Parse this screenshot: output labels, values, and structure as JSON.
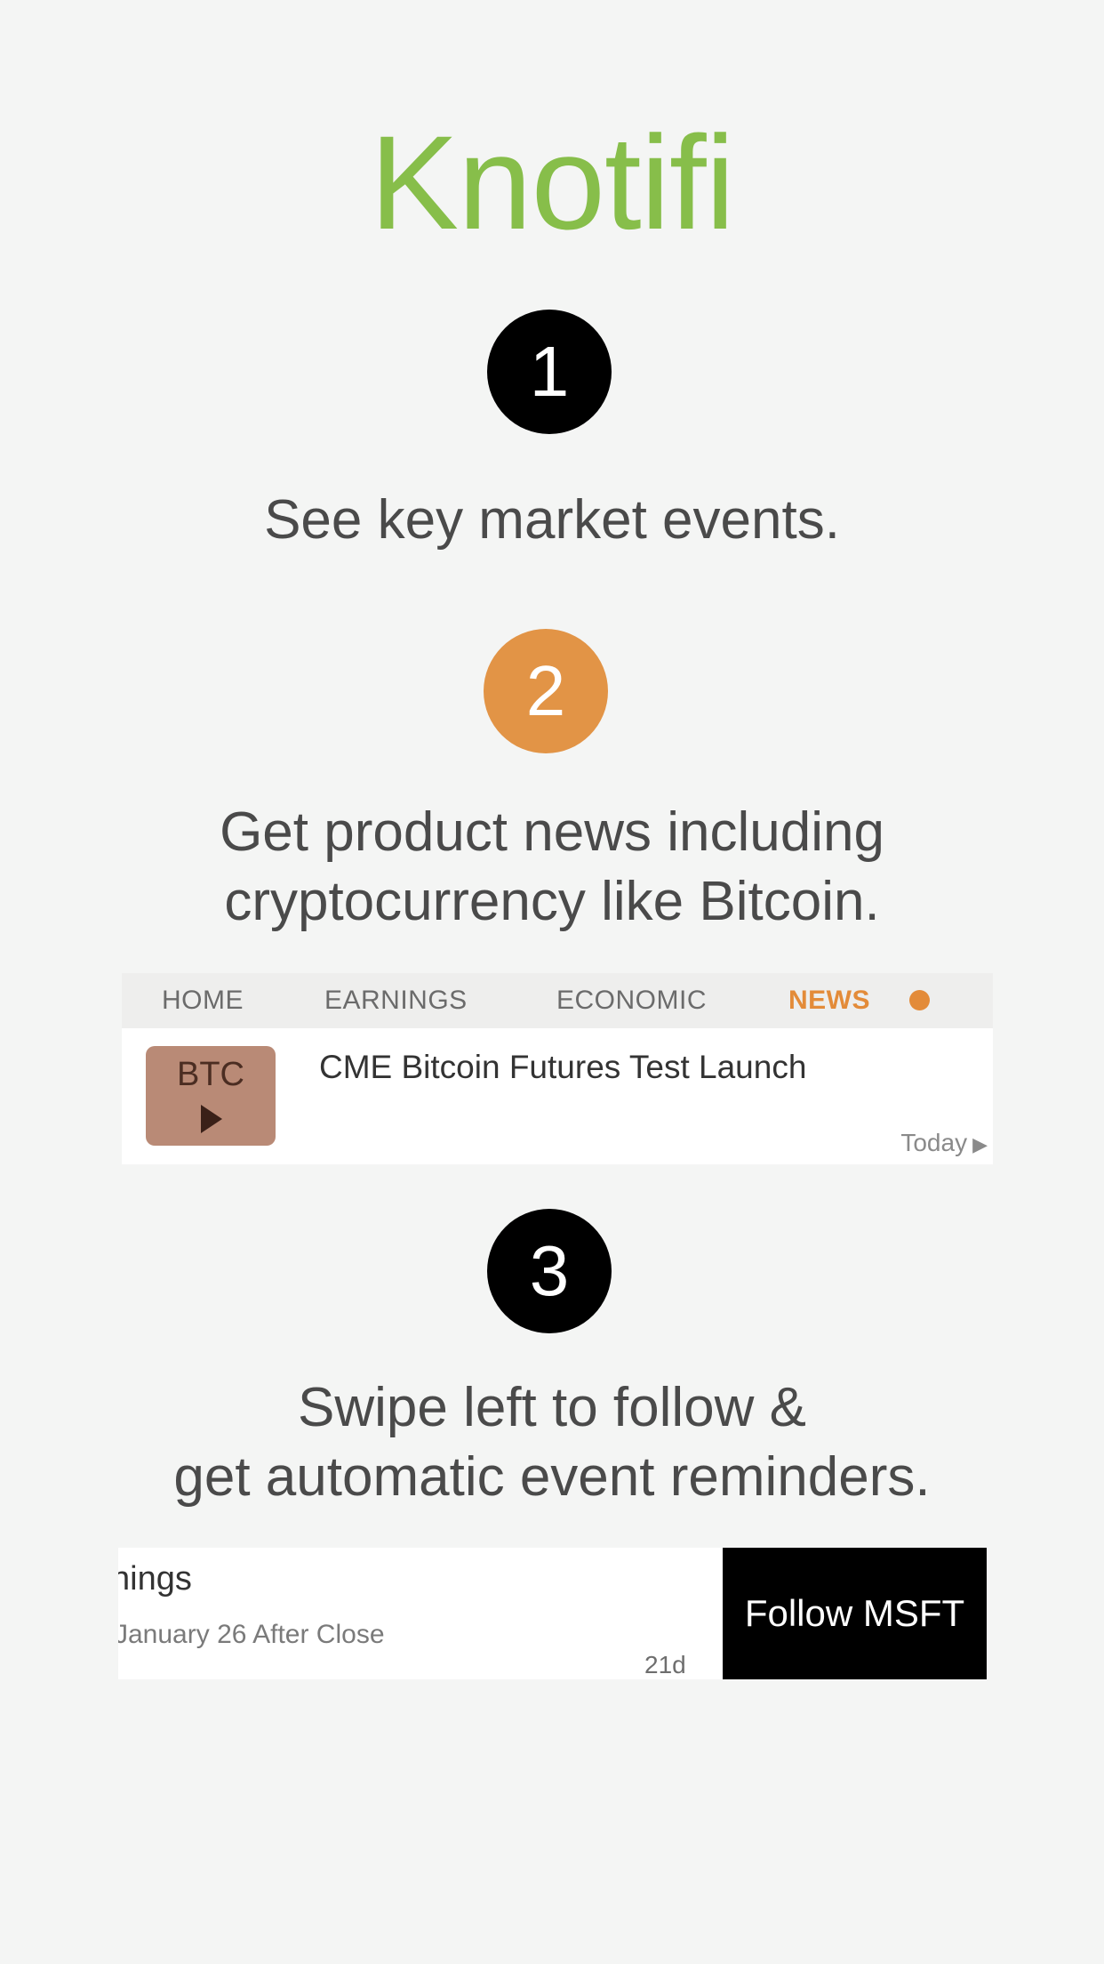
{
  "app": {
    "title": "Knotifi"
  },
  "steps": [
    {
      "number": "1",
      "caption_line1": "See key market events.",
      "color": "#000000"
    },
    {
      "number": "2",
      "caption_line1": "Get product news including",
      "caption_line2": "cryptocurrency like Bitcoin.",
      "color": "#e29446"
    },
    {
      "number": "3",
      "caption_line1": "Swipe left to follow &",
      "caption_line2": "get automatic event reminders.",
      "color": "#000000"
    }
  ],
  "news_card": {
    "tabs": [
      {
        "label": "HOME"
      },
      {
        "label": "EARNINGS"
      },
      {
        "label": "ECONOMIC"
      },
      {
        "label": "NEWS",
        "active": true
      }
    ],
    "item": {
      "ticker": "BTC",
      "headline": "CME Bitcoin Futures Test Launch",
      "time": "Today"
    }
  },
  "swipe_card": {
    "title": "nings",
    "subtitle": "January 26 After Close",
    "days": "21d",
    "follow_label": "Follow MSFT"
  },
  "colors": {
    "brand_green": "#87be4a",
    "accent_orange": "#e29446",
    "background": "#f4f5f4"
  }
}
